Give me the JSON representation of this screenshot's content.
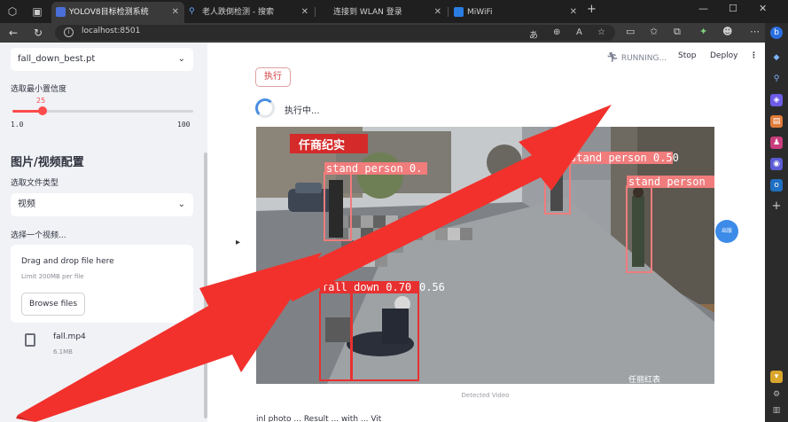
{
  "browser": {
    "tabs": [
      {
        "title": "YOLOV8目标检测系统",
        "active": true
      },
      {
        "title": "老人跌倒检测 - 搜索",
        "active": false
      },
      {
        "title": "连接到 WLAN 登录",
        "active": false
      },
      {
        "title": "MiWiFi",
        "active": false
      }
    ],
    "new_tab": "+",
    "url": "localhost:8501"
  },
  "sidebar": {
    "model_select": "fall_down_best.pt",
    "confidence_label": "选取最小置信度",
    "slider": {
      "value": "25",
      "min": "1.0",
      "max": "100",
      "fraction": 0.165
    },
    "section_title": "图片/视频配置",
    "file_type_label": "选取文件类型",
    "file_type_value": "视频",
    "choose_label": "选择一个视频...",
    "uploader": {
      "drag_text": "Drag and drop file here",
      "limit_text": "Limit 200MB per file",
      "browse_label": "Browse files"
    },
    "file": {
      "name": "fall.mp4",
      "size": "6.1MB"
    }
  },
  "topbar": {
    "running": "RUNNING...",
    "stop": "Stop",
    "deploy": "Deploy",
    "menu": "⋮"
  },
  "main": {
    "execute_label": "执行",
    "status_text": "执行中...",
    "video_caption": "Detected Video",
    "bottom_text": "inl photo ... Result ... with ... Vit"
  },
  "video": {
    "banner": "仟商纪实",
    "detections": [
      {
        "label": "stand person 0.",
        "color": "#f07c7c"
      },
      {
        "label": "stand person 0.50",
        "color": "#f07c7c"
      },
      {
        "label": "stand person",
        "color": "#f07c7c"
      },
      {
        "label": "fall down 0.70",
        "color": "#e83030"
      },
      {
        "label": "0.56",
        "color": "#e83030"
      }
    ],
    "bottom_caption": "任丽红表",
    "side_badge": "出版"
  },
  "colors": {
    "accent": "#ff4b4b",
    "arrow": "#f2312c",
    "sidebar_bg": "#f0f2f6"
  }
}
